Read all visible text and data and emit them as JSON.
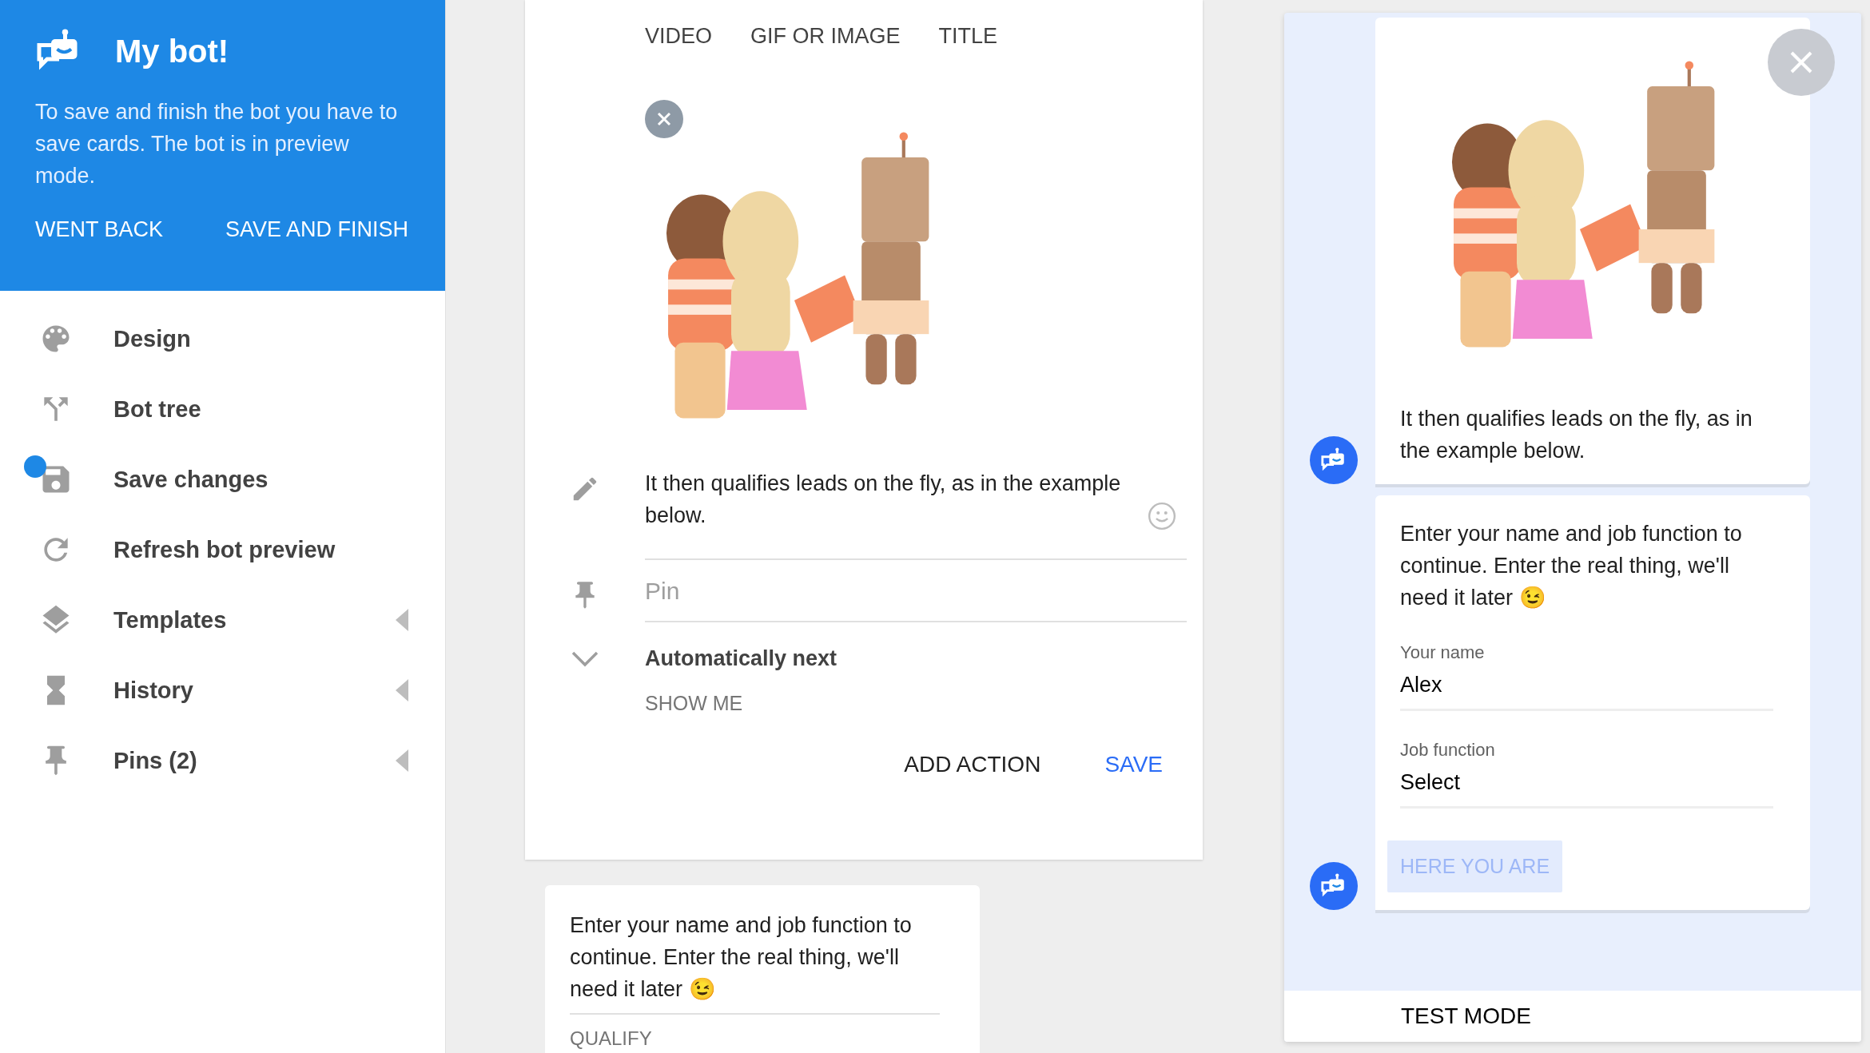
{
  "sidebar": {
    "title": "My bot!",
    "message": "To save and finish the bot you have to save cards. The bot is in preview mode.",
    "actions": [
      "WENT BACK",
      "SAVE AND FINISH"
    ],
    "items": [
      {
        "label": "Design",
        "notification": false,
        "has_submenu": false
      },
      {
        "label": "Bot tree",
        "notification": false,
        "has_submenu": false
      },
      {
        "label": "Save changes",
        "notification": true,
        "has_submenu": false
      },
      {
        "label": "Refresh bot preview",
        "notification": false,
        "has_submenu": false
      },
      {
        "label": "Templates",
        "notification": false,
        "has_submenu": true
      },
      {
        "label": "History",
        "notification": false,
        "has_submenu": true
      },
      {
        "label": "Pins (2)",
        "notification": false,
        "has_submenu": true
      }
    ]
  },
  "editor": {
    "add_buttons": [
      "VIDEO",
      "GIF OR IMAGE",
      "TITLE"
    ],
    "text_value": "It then qualifies leads on the fly, as in the example below.",
    "pin_placeholder": "Pin",
    "next_action": "Automatically next",
    "show_me": "SHOW ME",
    "actions": [
      {
        "label": "ADD ACTION",
        "primary": false
      },
      {
        "label": "SAVE",
        "primary": true
      }
    ]
  },
  "next_card": {
    "message": "Enter your name and job function to continue. Enter the real thing, we'll need it later 😉",
    "section": "QUALIFY"
  },
  "preview": {
    "messages": [
      {
        "kind": "image",
        "text": "It then qualifies leads on the fly, as in the example below."
      },
      {
        "kind": "form",
        "text": "Enter your name and job function to continue. Enter the real thing, we'll need it later 😉",
        "fields": [
          {
            "label": "Your name",
            "value": "Alex"
          },
          {
            "label": "Job function",
            "value": "Select"
          }
        ],
        "button": {
          "label": "HERE YOU ARE",
          "disabled": true
        }
      }
    ],
    "footer": "TEST MODE"
  }
}
